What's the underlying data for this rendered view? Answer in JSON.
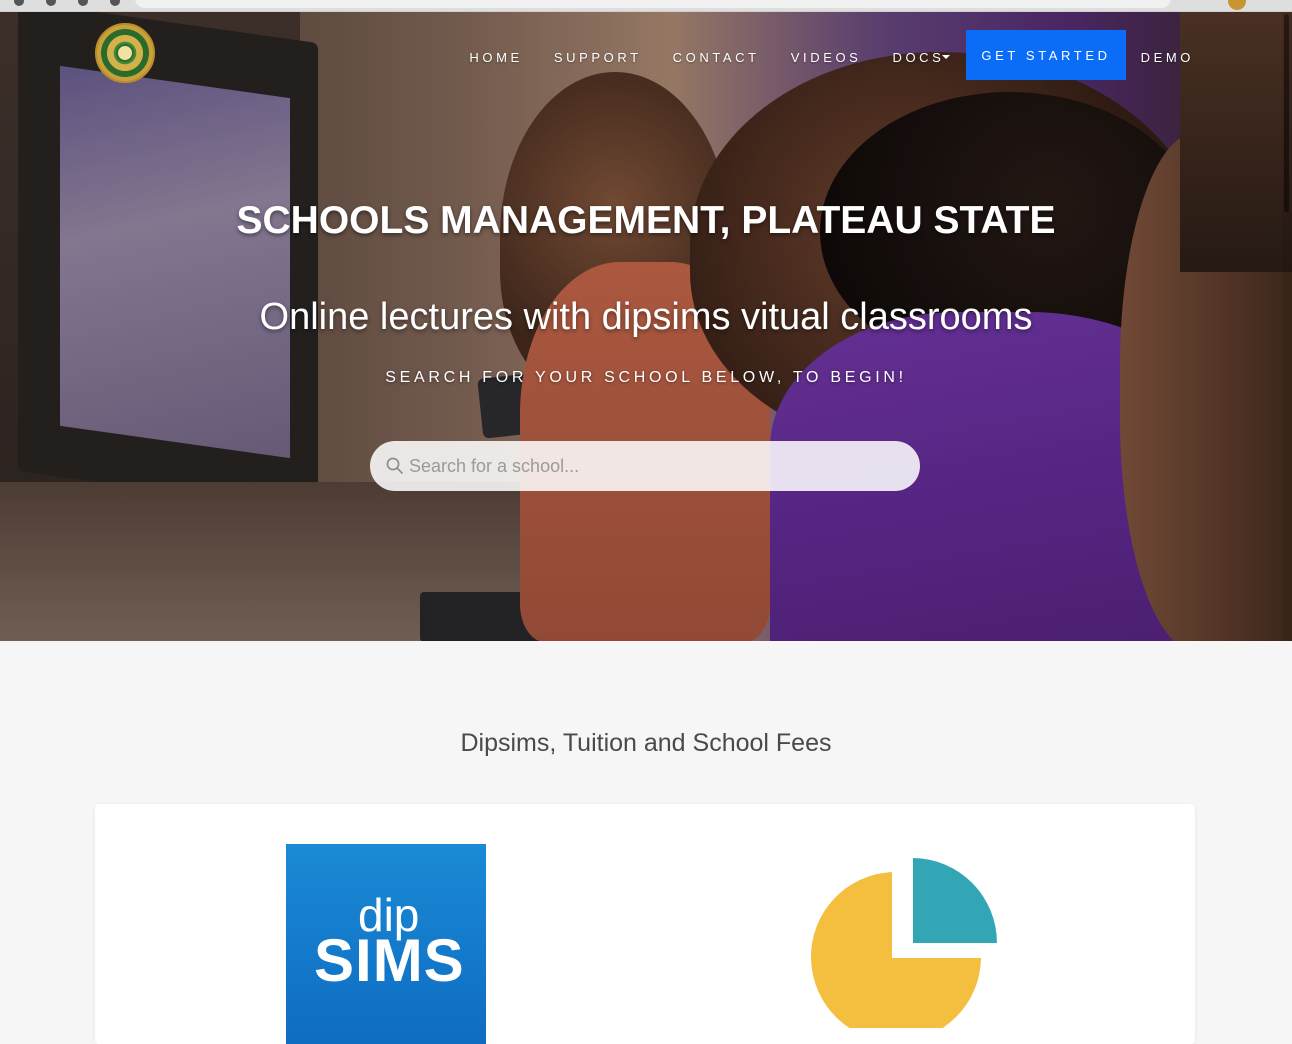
{
  "nav": {
    "items": [
      {
        "label": "HOME"
      },
      {
        "label": "SUPPORT"
      },
      {
        "label": "CONTACT"
      },
      {
        "label": "VIDEOS"
      },
      {
        "label": "DOCS"
      }
    ],
    "get_started": "GET STARTED",
    "demo": "DEMO"
  },
  "hero": {
    "title": "SCHOOLS MANAGEMENT, PLATEAU STATE",
    "subtitle": "Online lectures with dipsims vitual classrooms",
    "prompt": "SEARCH FOR YOUR SCHOOL BELOW, TO BEGIN!"
  },
  "search": {
    "placeholder": "Search for a school..."
  },
  "section": {
    "title": "Dipsims, Tuition and School Fees"
  },
  "card": {
    "dip_text": "dip",
    "sims_text": "SIMS"
  },
  "icons": {
    "search": "search-icon",
    "pie": "pie-chart-icon",
    "docs_caret": "caret-down-icon"
  },
  "colors": {
    "accent": "#0b6cf7",
    "dipsims_blue": "#1278cc",
    "pie_yellow": "#f4be3e",
    "pie_teal": "#33a6b5"
  }
}
